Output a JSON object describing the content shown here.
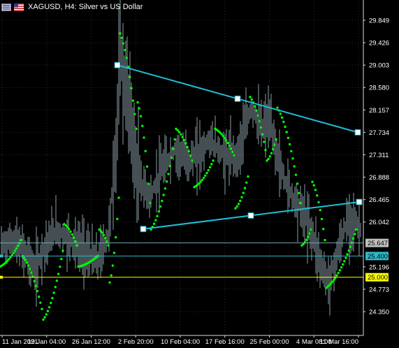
{
  "header": {
    "title": "XAGUSD, H4:  Silver vs US Dollar",
    "menu_icon": "window-menu-icon",
    "flag_icon": "us-flag-icon"
  },
  "colors": {
    "background": "#000000",
    "grid": "#2a2a2a",
    "candles": "#8a9ea6",
    "parabolic_sar": "#00ff00",
    "trendline": "#1fbfd8",
    "level_lines": "#6fa6b0",
    "level_25000": "#ffff00"
  },
  "y_axis": {
    "ticks": [
      "29.849",
      "29.426",
      "29.003",
      "28.580",
      "28.157",
      "27.734",
      "27.311",
      "26.888",
      "26.465",
      "26.042",
      "25.196",
      "24.773",
      "24.350"
    ],
    "tick_values": [
      29.849,
      29.426,
      29.003,
      28.58,
      28.157,
      27.734,
      27.311,
      26.888,
      26.465,
      26.042,
      25.196,
      24.773,
      24.35
    ]
  },
  "x_axis": {
    "ticks": [
      "11 Jan 2021",
      "19 Jan 04:00",
      "26 Jan 12:00",
      "2 Feb 20:00",
      "10 Feb 04:00",
      "17 Feb 16:00",
      "25 Feb 00:00",
      "4 Mar 08:00",
      "11 Mar 16:00"
    ]
  },
  "price_levels": [
    {
      "label": "25.647",
      "value": 25.647,
      "style": "grey"
    },
    {
      "label": "25.400",
      "value": 25.4,
      "style": "cyan"
    },
    {
      "label": "25.000",
      "value": 25.0,
      "style": "yellow"
    }
  ],
  "trendlines": [
    {
      "name": "upper-trendline",
      "from_value": 29.003,
      "to_value": 27.734
    },
    {
      "name": "lower-trendline",
      "from_value": 25.91,
      "to_value": 26.42
    }
  ]
}
